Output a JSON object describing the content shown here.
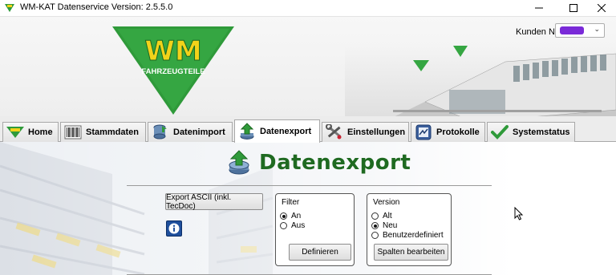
{
  "window": {
    "title": "WM-KAT Datenservice  Version: 2.5.5.0",
    "controls": {
      "minimize": "minimize",
      "maximize": "maximize",
      "close": "close"
    }
  },
  "header": {
    "logo": {
      "text": "WM",
      "subtext": "FAHRZEUGTEILE"
    },
    "kunden_label": "Kunden Nr:",
    "kunden_value": ""
  },
  "tabs": [
    {
      "label": "Home",
      "icon": "wm-logo-icon",
      "active": false
    },
    {
      "label": "Stammdaten",
      "icon": "barcode-icon",
      "active": false
    },
    {
      "label": "Datenimport",
      "icon": "database-icon",
      "active": false
    },
    {
      "label": "Datenexport",
      "icon": "export-arrow-icon",
      "active": true
    },
    {
      "label": "Einstellungen",
      "icon": "tools-icon",
      "active": false
    },
    {
      "label": "Protokolle",
      "icon": "log-icon",
      "active": false
    },
    {
      "label": "Systemstatus",
      "icon": "check-icon",
      "active": false
    }
  ],
  "main": {
    "heading": "Datenexport",
    "export_button": "Export ASCII (inkl. TecDoc)",
    "info_icon": "i",
    "filter": {
      "title": "Filter",
      "options": [
        {
          "label": "An",
          "selected": true
        },
        {
          "label": "Aus",
          "selected": false
        }
      ],
      "button": "Definieren"
    },
    "version": {
      "title": "Version",
      "options": [
        {
          "label": "Alt",
          "selected": false
        },
        {
          "label": "Neu",
          "selected": true
        },
        {
          "label": "Benutzerdefiniert",
          "selected": false
        }
      ],
      "button": "Spalten bearbeiten"
    }
  },
  "colors": {
    "brand_green": "#1f6a21",
    "logo_yellow": "#f2d21a",
    "logo_green": "#2f9a3a"
  }
}
